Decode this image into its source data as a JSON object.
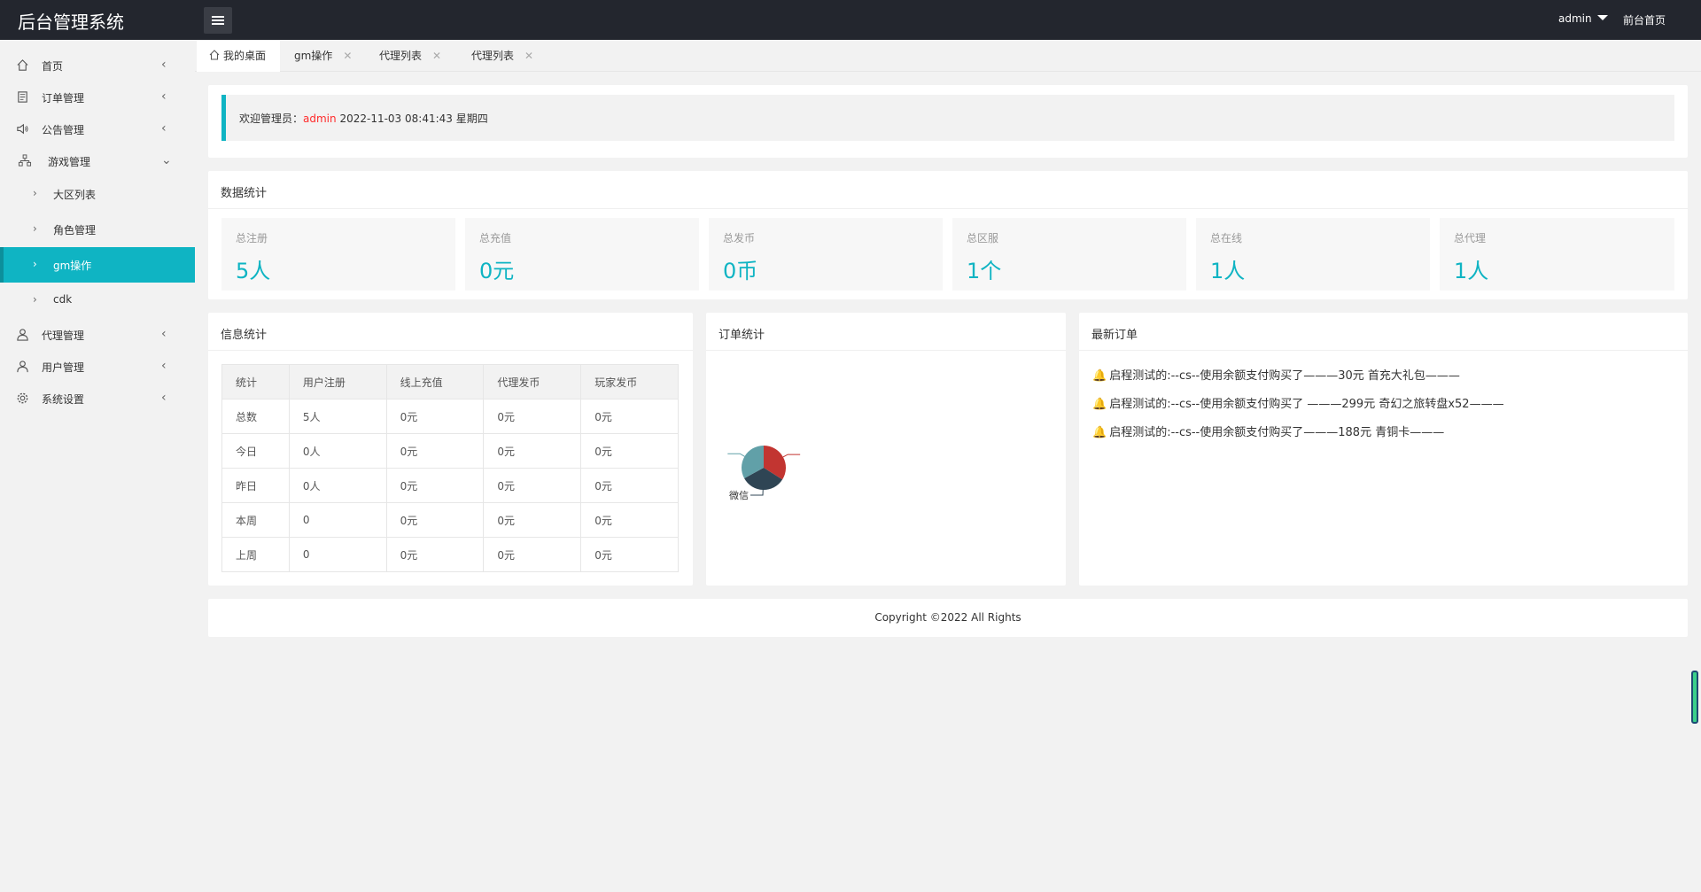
{
  "header": {
    "title": "后台管理系统",
    "user": "admin",
    "front_link": "前台首页"
  },
  "sidebar": {
    "items": [
      {
        "label": "首页",
        "icon": "home-icon",
        "arrow": "‹"
      },
      {
        "label": "订单管理",
        "icon": "document-icon",
        "arrow": "‹"
      },
      {
        "label": "公告管理",
        "icon": "speaker-icon",
        "arrow": "‹"
      },
      {
        "label": "游戏管理",
        "icon": "sitemap-icon",
        "arrow": "⌄"
      },
      {
        "label": "代理管理",
        "icon": "user-icon",
        "arrow": "‹"
      },
      {
        "label": "用户管理",
        "icon": "user-icon",
        "arrow": "‹"
      },
      {
        "label": "系统设置",
        "icon": "gear-icon",
        "arrow": "‹"
      }
    ],
    "sub_items": [
      {
        "label": "大区列表"
      },
      {
        "label": "角色管理"
      },
      {
        "label": "gm操作"
      },
      {
        "label": "cdk"
      }
    ]
  },
  "tabs": [
    {
      "label": "我的桌面"
    },
    {
      "label": "gm操作"
    },
    {
      "label": "代理列表"
    },
    {
      "label": "代理列表"
    }
  ],
  "welcome": {
    "prefix": "欢迎管理员：",
    "user": "admin",
    "datetime": "2022-11-03  08:41:43  星期四"
  },
  "data_stats": {
    "title": "数据统计",
    "boxes": [
      {
        "label": "总注册",
        "value": "5人"
      },
      {
        "label": "总充值",
        "value": "0元"
      },
      {
        "label": "总发币",
        "value": "0币"
      },
      {
        "label": "总区服",
        "value": "1个"
      },
      {
        "label": "总在线",
        "value": "1人"
      },
      {
        "label": "总代理",
        "value": "1人"
      }
    ]
  },
  "info_stats": {
    "title": "信息统计",
    "headers": [
      "统计",
      "用户注册",
      "线上充值",
      "代理发币",
      "玩家发币"
    ],
    "rows": [
      [
        "总数",
        "5人",
        "0元",
        "0元",
        "0元"
      ],
      [
        "今日",
        "0人",
        "0元",
        "0元",
        "0元"
      ],
      [
        "昨日",
        "0人",
        "0元",
        "0元",
        "0元"
      ],
      [
        "本周",
        "0",
        "0元",
        "0元",
        "0元"
      ],
      [
        "上周",
        "0",
        "0元",
        "0元",
        "0元"
      ]
    ]
  },
  "order_stats": {
    "title": "订单统计",
    "label": "微信"
  },
  "chart_data": {
    "type": "pie",
    "values": [
      34,
      33,
      33
    ],
    "colors": [
      "#c23531",
      "#2f4554",
      "#61a0a8"
    ],
    "labels": [
      "",
      "微信",
      ""
    ]
  },
  "latest_orders": {
    "title": "最新订单",
    "items": [
      "启程测试的:--cs--使用余额支付购买了———30元 首充大礼包———",
      "启程测试的:--cs--使用余额支付购买了 ———299元 奇幻之旅转盘x52———",
      "启程测试的:--cs--使用余额支付购买了———188元 青铜卡———"
    ]
  },
  "footer": {
    "copyright": "Copyright ©2022 All Rights"
  }
}
